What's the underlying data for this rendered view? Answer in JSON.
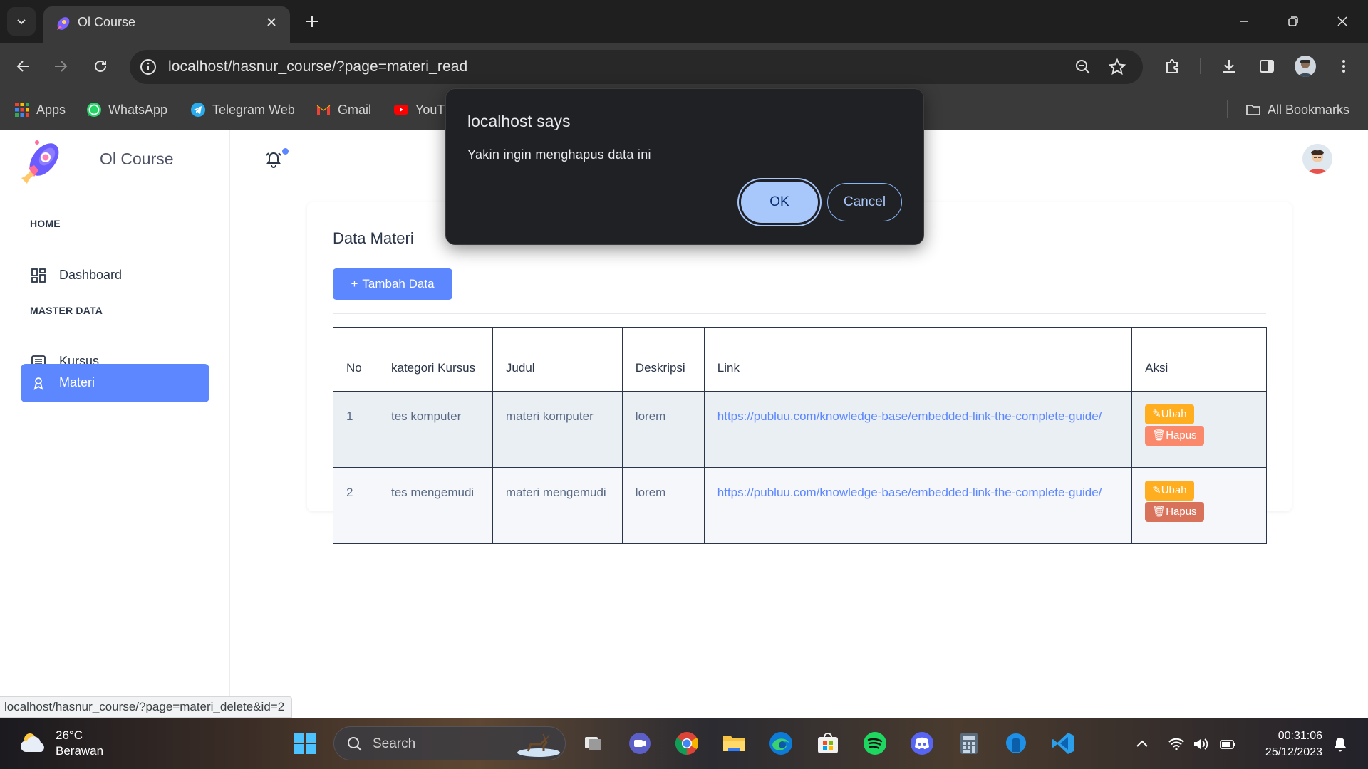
{
  "browser": {
    "tab_title": "Ol Course",
    "url": "localhost/hasnur_course/?page=materi_read",
    "bookmarks": [
      {
        "label": "Apps",
        "icon": "apps-grid-icon"
      },
      {
        "label": "WhatsApp",
        "icon": "whatsapp-icon"
      },
      {
        "label": "Telegram Web",
        "icon": "telegram-icon"
      },
      {
        "label": "Gmail",
        "icon": "gmail-icon"
      },
      {
        "label": "YouT",
        "icon": "youtube-icon"
      }
    ],
    "all_bookmarks": "All Bookmarks"
  },
  "sidebar": {
    "brand": "Ol Course",
    "section_home": "HOME",
    "section_master": "MASTER DATA",
    "items": [
      {
        "label": "Dashboard",
        "icon": "dashboard-icon"
      },
      {
        "label": "Kursus",
        "icon": "list-icon"
      },
      {
        "label": "Materi",
        "icon": "certificate-icon",
        "active": true
      }
    ]
  },
  "main": {
    "card_title": "Data Materi",
    "add_button": "Tambah Data",
    "add_button_prefix": "+",
    "columns": [
      "No",
      "kategori Kursus",
      "Judul",
      "Deskripsi",
      "Link",
      "Aksi"
    ],
    "rows": [
      {
        "no": "1",
        "kategori": "tes komputer",
        "judul": "materi komputer",
        "deskripsi": "lorem",
        "link": "https://publuu.com/knowledge-base/embedded-link-the-complete-guide/",
        "ubah": "Ubah",
        "hapus": "Hapus"
      },
      {
        "no": "2",
        "kategori": "tes mengemudi",
        "judul": "materi mengemudi",
        "deskripsi": "lorem",
        "link": "https://publuu.com/knowledge-base/embedded-link-the-complete-guide/",
        "ubah": "Ubah",
        "hapus": "Hapus"
      }
    ]
  },
  "dialog": {
    "title": "localhost says",
    "message": "Yakin ingin menghapus data ini",
    "ok": "OK",
    "cancel": "Cancel"
  },
  "status_url": "localhost/hasnur_course/?page=materi_delete&id=2",
  "taskbar": {
    "temperature": "26°C",
    "weather": "Berawan",
    "search_placeholder": "Search",
    "time": "00:31:06",
    "date": "25/12/2023"
  },
  "colors": {
    "accent": "#5d87ff",
    "warning": "#ffae1f",
    "danger": "#fa896b",
    "dialog_bg": "#202124",
    "dialog_ok": "#a8c7fa"
  }
}
